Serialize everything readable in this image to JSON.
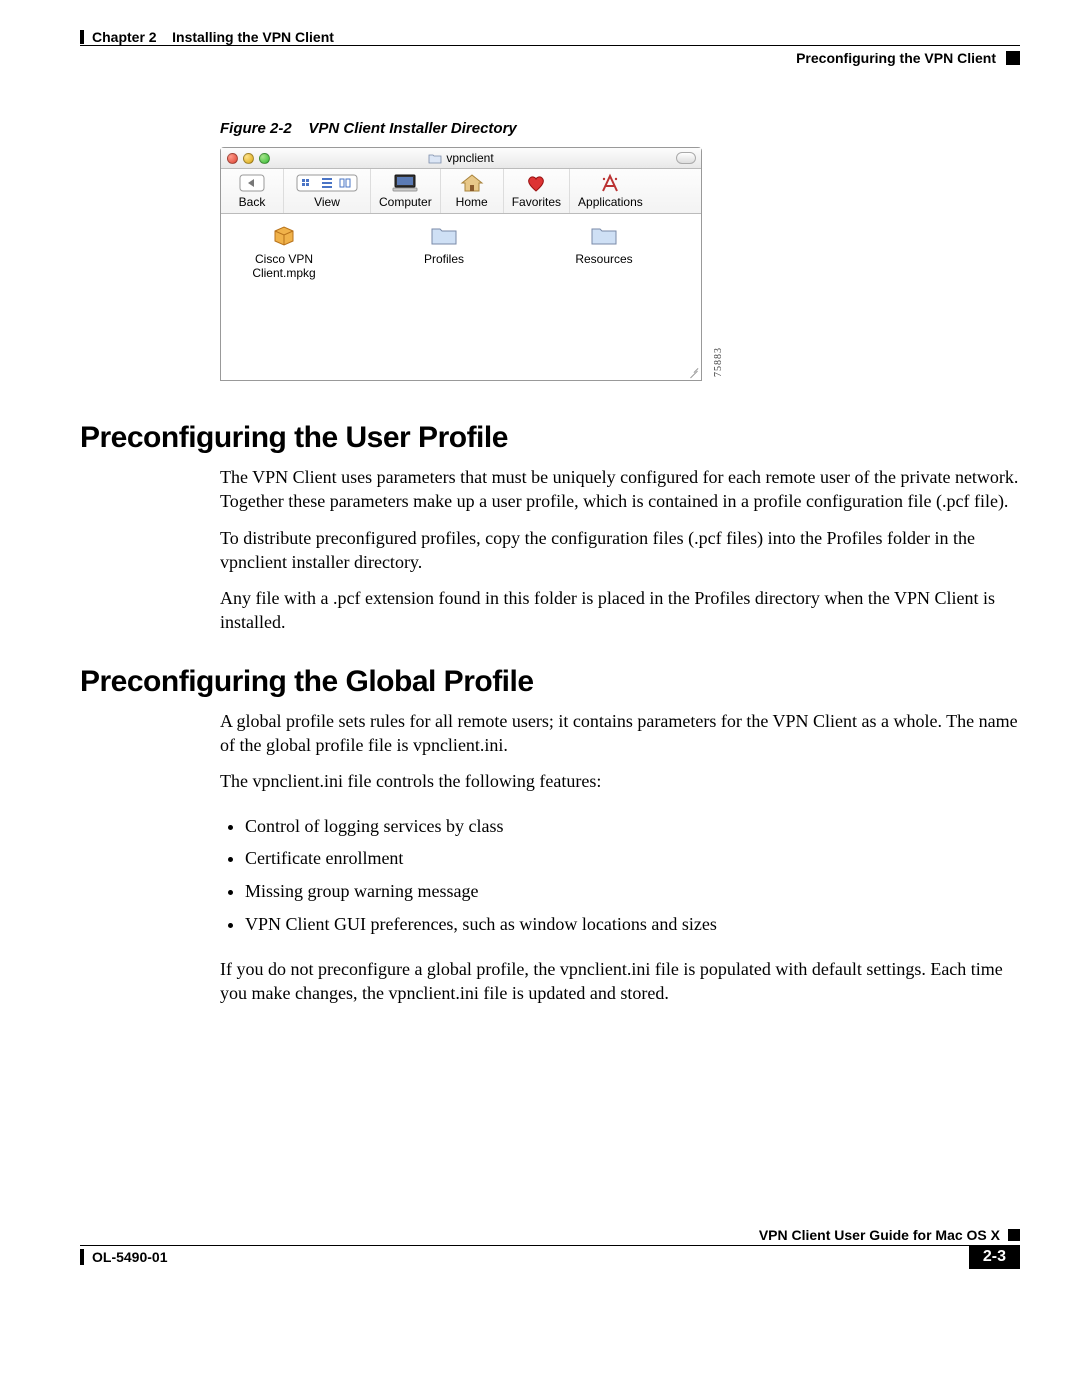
{
  "header": {
    "chapter_label": "Chapter 2",
    "chapter_title": "Installing the VPN Client",
    "section_title": "Preconfiguring the VPN Client"
  },
  "figure": {
    "caption_prefix": "Figure 2-2",
    "caption_title": "VPN Client Installer Directory",
    "window_title": "vpnclient",
    "toolbar": {
      "back": "Back",
      "view": "View",
      "computer": "Computer",
      "home": "Home",
      "favorites": "Favorites",
      "applications": "Applications"
    },
    "files": {
      "mpkg": "Cisco VPN Client.mpkg",
      "profiles": "Profiles",
      "resources": "Resources"
    },
    "side_number": "75883"
  },
  "section1": {
    "heading": "Preconfiguring the User Profile",
    "p1": "The VPN Client uses parameters that must be uniquely configured for each remote user of the private network. Together these parameters make up a user profile, which is contained in a profile configuration file (.pcf file).",
    "p2": "To distribute preconfigured profiles, copy the configuration files (.pcf files) into the Profiles folder in the vpnclient installer directory.",
    "p3": "Any file with a .pcf extension found in this folder is placed in the Profiles directory when the VPN Client is installed."
  },
  "section2": {
    "heading": "Preconfiguring the Global Profile",
    "p1": "A global profile sets rules for all remote users; it contains parameters for the VPN Client as a whole. The name of the global profile file is vpnclient.ini.",
    "p2": "The vpnclient.ini file controls the following features:",
    "bullets": {
      "b1": "Control of logging services by class",
      "b2": "Certificate enrollment",
      "b3": "Missing group warning message",
      "b4": "VPN Client GUI preferences, such as window locations and sizes"
    },
    "p3": "If you do not preconfigure a global profile, the vpnclient.ini file is populated with default settings. Each time you make changes, the vpnclient.ini file is updated and stored."
  },
  "footer": {
    "doc_title": "VPN Client User Guide for Mac OS X",
    "doc_id": "OL-5490-01",
    "page_number": "2-3"
  }
}
